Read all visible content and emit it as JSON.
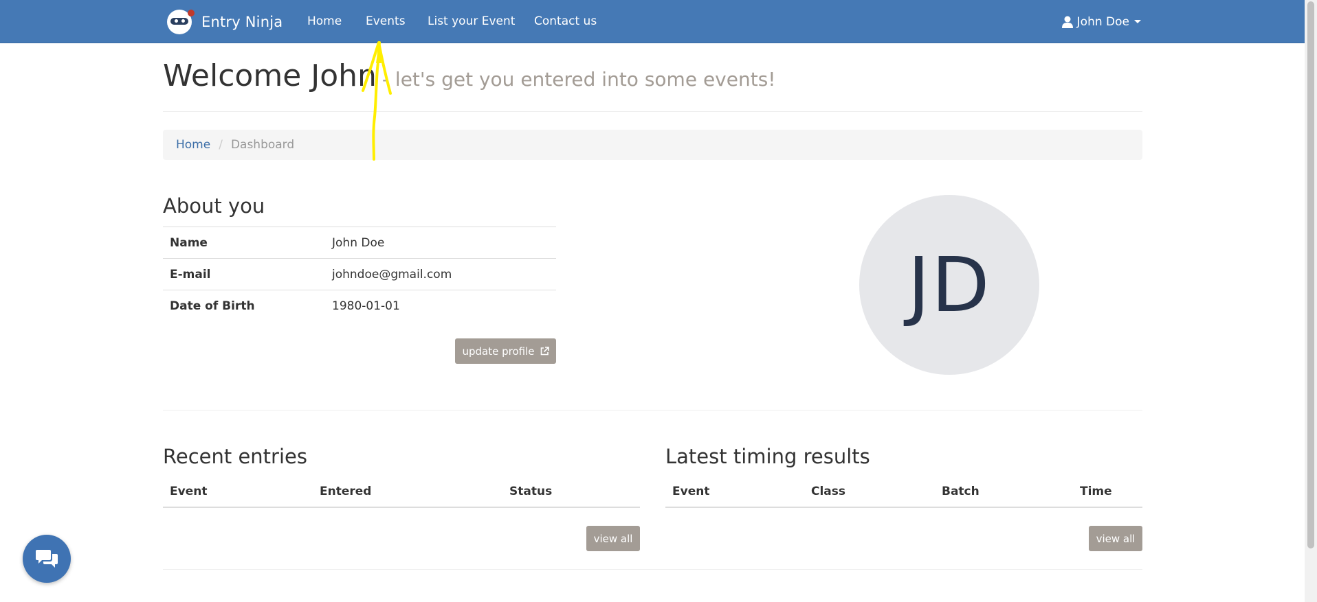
{
  "navbar": {
    "brand": "Entry Ninja",
    "links": [
      "Home",
      "Events",
      "List your Event",
      "Contact us"
    ],
    "user": "John Doe",
    "bg_color": "#4579b5"
  },
  "header": {
    "title": "Welcome John",
    "subtitle": "- let's get you entered into some events!"
  },
  "breadcrumb": {
    "home": "Home",
    "separator": "/",
    "current": "Dashboard"
  },
  "about": {
    "title": "About you",
    "rows": [
      {
        "label": "Name",
        "value": "John Doe"
      },
      {
        "label": "E-mail",
        "value": "johndoe@gmail.com"
      },
      {
        "label": "Date of Birth",
        "value": "1980-01-01"
      }
    ],
    "update_button": "update profile",
    "avatar_initials": "JD"
  },
  "recent_entries": {
    "title": "Recent entries",
    "columns": [
      "Event",
      "Entered",
      "Status"
    ],
    "view_all": "view all"
  },
  "timing_results": {
    "title": "Latest timing results",
    "columns": [
      "Event",
      "Class",
      "Batch",
      "Time"
    ],
    "view_all": "view all"
  },
  "icons": {
    "logo": "ninja-logo-icon",
    "user": "user-icon",
    "external_link": "external-link-icon",
    "chat": "chat-icon"
  },
  "annotation_color": "#ffee00"
}
